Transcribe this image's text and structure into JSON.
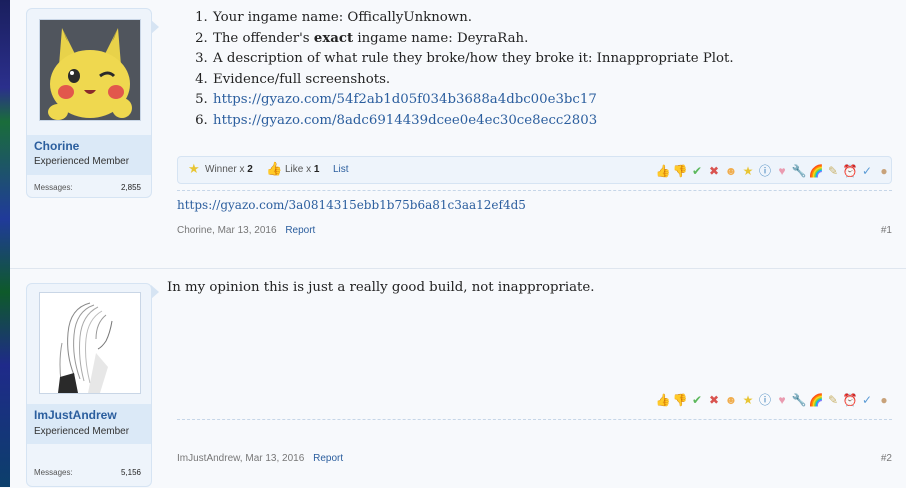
{
  "posts": [
    {
      "username": "Chorine",
      "user_title": "Experienced Member",
      "messages_label": "Messages:",
      "messages_count": "2,855",
      "rules": [
        {
          "prefix": "Your ingame name: ",
          "bold": "",
          "suffix": "OfficallyUnknown."
        },
        {
          "prefix": "The offender's ",
          "bold": "exact",
          "suffix": " ingame name: DeyraRah."
        },
        {
          "prefix": "A description of what rule they broke/how they broke it: Innappropriate Plot.",
          "bold": "",
          "suffix": ""
        },
        {
          "prefix": "Evidence/full screenshots.",
          "bold": "",
          "suffix": ""
        }
      ],
      "links": [
        "https://gyazo.com/54f2ab1d05f034b3688a4dbc00e3bc17",
        "https://gyazo.com/8adc6914439dcee0e4ec30ce8ecc2803"
      ],
      "likes": {
        "winner_label": "Winner x",
        "winner_count": "2",
        "like_label": "Like x",
        "like_count": "1",
        "list_label": "List"
      },
      "signature_link": "https://gyazo.com/3a0814315ebb1b75b6a81c3aa12ef4d5",
      "meta_author": "Chorine,",
      "meta_date": "Mar 13, 2016",
      "report_label": "Report",
      "post_number": "#1"
    },
    {
      "username": "ImJustAndrew",
      "user_title": "Experienced Member",
      "messages_label": "Messages:",
      "messages_count": "5,156",
      "body": "In my opinion this is just a really good build, not inappropriate.",
      "meta_author": "ImJustAndrew,",
      "meta_date": "Mar 13, 2016",
      "report_label": "Report",
      "post_number": "#2"
    }
  ],
  "rating_icons": [
    {
      "name": "like-icon",
      "glyph": "👍",
      "color": "#d9a066"
    },
    {
      "name": "dislike-icon",
      "glyph": "👎",
      "color": "#d9a066"
    },
    {
      "name": "agree-icon",
      "glyph": "✔",
      "color": "#5cb85c"
    },
    {
      "name": "disagree-icon",
      "glyph": "✖",
      "color": "#d9534f"
    },
    {
      "name": "funny-icon",
      "glyph": "☻",
      "color": "#f0ad4e"
    },
    {
      "name": "winner-icon",
      "glyph": "★",
      "color": "#e8c534"
    },
    {
      "name": "informative-icon",
      "glyph": "ⓘ",
      "color": "#337ab7"
    },
    {
      "name": "friendly-icon",
      "glyph": "♥",
      "color": "#ea9bb0"
    },
    {
      "name": "useful-icon",
      "glyph": "🔧",
      "color": "#999999"
    },
    {
      "name": "creative-icon",
      "glyph": "🌈",
      "color": "#e76b6b"
    },
    {
      "name": "optimistic-icon",
      "glyph": "✎",
      "color": "#c9b26a"
    },
    {
      "name": "late-icon",
      "glyph": "⏰",
      "color": "#e25b4b"
    },
    {
      "name": "bad-spelling-icon",
      "glyph": "✓",
      "color": "#5b9bd5"
    },
    {
      "name": "cookie-icon",
      "glyph": "●",
      "color": "#c8a27a"
    }
  ]
}
